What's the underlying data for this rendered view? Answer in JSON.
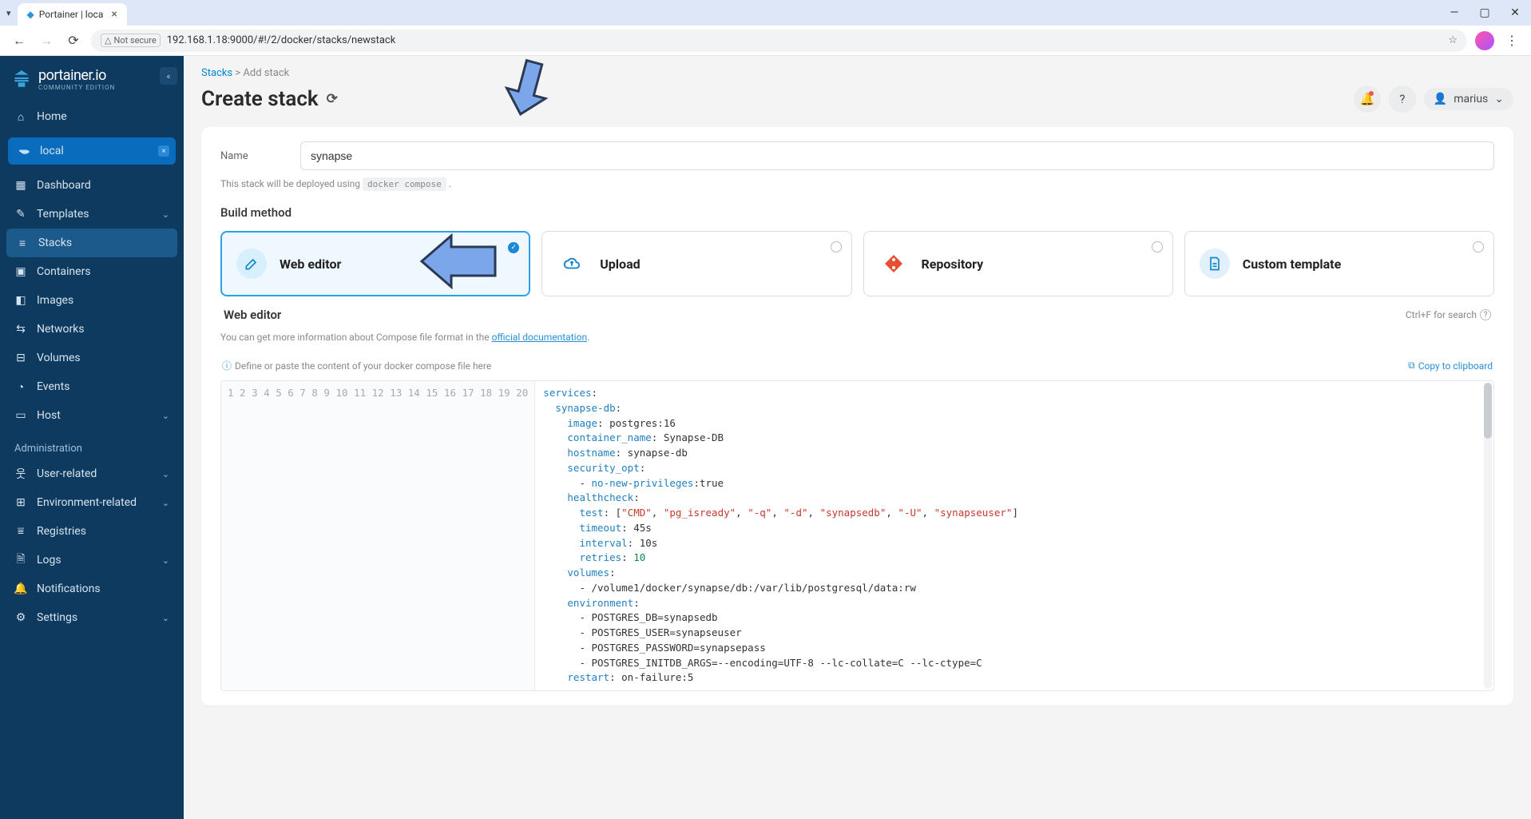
{
  "browser": {
    "tab_title": "Portainer | loca",
    "url": "192.168.1.18:9000/#!/2/docker/stacks/newstack",
    "secure_label": "Not secure"
  },
  "sidebar": {
    "brand": "portainer.io",
    "brand_sub": "COMMUNITY EDITION",
    "home": "Home",
    "env_label": "local",
    "nav": {
      "dashboard": "Dashboard",
      "templates": "Templates",
      "stacks": "Stacks",
      "containers": "Containers",
      "images": "Images",
      "networks": "Networks",
      "volumes": "Volumes",
      "events": "Events",
      "host": "Host"
    },
    "admin_label": "Administration",
    "admin": {
      "user_related": "User-related",
      "env_related": "Environment-related",
      "registries": "Registries",
      "logs": "Logs",
      "notifications": "Notifications",
      "settings": "Settings"
    }
  },
  "header": {
    "crumb_root": "Stacks",
    "crumb_leaf": "Add stack",
    "title": "Create stack",
    "user": "marius"
  },
  "form": {
    "name_label": "Name",
    "name_value": "synapse",
    "helper_pre": "This stack will be deployed using ",
    "helper_code": "docker compose",
    "build_label": "Build method",
    "methods": {
      "web": "Web editor",
      "upload": "Upload",
      "repo": "Repository",
      "custom": "Custom template"
    }
  },
  "editor": {
    "title": "Web editor",
    "search_hint": "Ctrl+F for search",
    "doc_hint_pre": "You can get more information about Compose file format in the ",
    "doc_hint_link": "official documentation",
    "placeholder_hint": "Define or paste the content of your docker compose file here",
    "copy": "Copy to clipboard",
    "lines": [
      "services:",
      "  synapse-db:",
      "    image: postgres:16",
      "    container_name: Synapse-DB",
      "    hostname: synapse-db",
      "    security_opt:",
      "      - no-new-privileges:true",
      "    healthcheck:",
      "      test: [\"CMD\", \"pg_isready\", \"-q\", \"-d\", \"synapsedb\", \"-U\", \"synapseuser\"]",
      "      timeout: 45s",
      "      interval: 10s",
      "      retries: 10",
      "    volumes:",
      "      - /volume1/docker/synapse/db:/var/lib/postgresql/data:rw",
      "    environment:",
      "      - POSTGRES_DB=synapsedb",
      "      - POSTGRES_USER=synapseuser",
      "      - POSTGRES_PASSWORD=synapsepass",
      "      - POSTGRES_INITDB_ARGS=--encoding=UTF-8 --lc-collate=C --lc-ctype=C",
      "    restart: on-failure:5"
    ]
  }
}
